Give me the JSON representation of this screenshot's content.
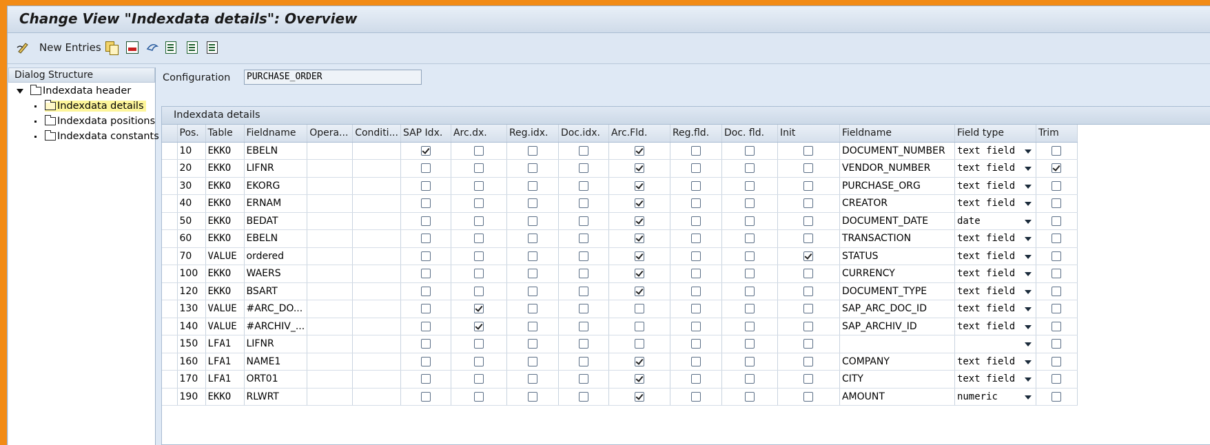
{
  "title": "Change View \"Indexdata details\": Overview",
  "toolbar": {
    "new_entries": "New Entries"
  },
  "dialog_structure": {
    "header": "Dialog Structure",
    "root": "Indexdata header",
    "items": [
      "Indexdata details",
      "Indexdata positions",
      "Indexdata constants"
    ],
    "selected": "Indexdata details"
  },
  "config": {
    "label": "Configuration",
    "value": "PURCHASE_ORDER"
  },
  "section_title": "Indexdata details",
  "columns": [
    "Pos.",
    "Table",
    "Fieldname",
    "Opera...",
    "Conditi...",
    "SAP Idx.",
    "Arc.dx.",
    "Reg.idx.",
    "Doc.idx.",
    "Arc.Fld.",
    "Reg.fld.",
    "Doc. fld.",
    "Init",
    "Fieldname",
    "Field type",
    "Trim"
  ],
  "rows": [
    {
      "pos": "10",
      "table": "EKKO",
      "field": "EBELN",
      "sap": true,
      "arc": false,
      "reg": false,
      "doc": false,
      "arcfld": true,
      "regfld": false,
      "docfld": false,
      "init": false,
      "fname": "DOCUMENT_NUMBER",
      "ftype": "text field",
      "trim": false
    },
    {
      "pos": "20",
      "table": "EKKO",
      "field": "LIFNR",
      "sap": false,
      "arc": false,
      "reg": false,
      "doc": false,
      "arcfld": true,
      "regfld": false,
      "docfld": false,
      "init": false,
      "fname": "VENDOR_NUMBER",
      "ftype": "text field",
      "trim": true
    },
    {
      "pos": "30",
      "table": "EKKO",
      "field": "EKORG",
      "sap": false,
      "arc": false,
      "reg": false,
      "doc": false,
      "arcfld": true,
      "regfld": false,
      "docfld": false,
      "init": false,
      "fname": "PURCHASE_ORG",
      "ftype": "text field",
      "trim": false
    },
    {
      "pos": "40",
      "table": "EKKO",
      "field": "ERNAM",
      "sap": false,
      "arc": false,
      "reg": false,
      "doc": false,
      "arcfld": true,
      "regfld": false,
      "docfld": false,
      "init": false,
      "fname": "CREATOR",
      "ftype": "text field",
      "trim": false
    },
    {
      "pos": "50",
      "table": "EKKO",
      "field": "BEDAT",
      "sap": false,
      "arc": false,
      "reg": false,
      "doc": false,
      "arcfld": true,
      "regfld": false,
      "docfld": false,
      "init": false,
      "fname": "DOCUMENT_DATE",
      "ftype": "date",
      "trim": false
    },
    {
      "pos": "60",
      "table": "EKKO",
      "field": "EBELN",
      "sap": false,
      "arc": false,
      "reg": false,
      "doc": false,
      "arcfld": true,
      "regfld": false,
      "docfld": false,
      "init": false,
      "fname": "TRANSACTION",
      "ftype": "text field",
      "trim": false
    },
    {
      "pos": "70",
      "table": "VALUE",
      "field": "ordered",
      "sap": false,
      "arc": false,
      "reg": false,
      "doc": false,
      "arcfld": true,
      "regfld": false,
      "docfld": false,
      "init": true,
      "fname": "STATUS",
      "ftype": "text field",
      "trim": false
    },
    {
      "pos": "100",
      "table": "EKKO",
      "field": "WAERS",
      "sap": false,
      "arc": false,
      "reg": false,
      "doc": false,
      "arcfld": true,
      "regfld": false,
      "docfld": false,
      "init": false,
      "fname": "CURRENCY",
      "ftype": "text field",
      "trim": false
    },
    {
      "pos": "120",
      "table": "EKKO",
      "field": "BSART",
      "sap": false,
      "arc": false,
      "reg": false,
      "doc": false,
      "arcfld": true,
      "regfld": false,
      "docfld": false,
      "init": false,
      "fname": "DOCUMENT_TYPE",
      "ftype": "text field",
      "trim": false
    },
    {
      "pos": "130",
      "table": "VALUE",
      "field": "#ARC_DO...",
      "sap": false,
      "arc": true,
      "reg": false,
      "doc": false,
      "arcfld": false,
      "regfld": false,
      "docfld": false,
      "init": false,
      "fname": "SAP_ARC_DOC_ID",
      "ftype": "text field",
      "trim": false
    },
    {
      "pos": "140",
      "table": "VALUE",
      "field": "#ARCHIV_...",
      "sap": false,
      "arc": true,
      "reg": false,
      "doc": false,
      "arcfld": false,
      "regfld": false,
      "docfld": false,
      "init": false,
      "fname": "SAP_ARCHIV_ID",
      "ftype": "text field",
      "trim": false
    },
    {
      "pos": "150",
      "table": "LFA1",
      "field": "LIFNR",
      "sap": false,
      "arc": false,
      "reg": false,
      "doc": false,
      "arcfld": false,
      "regfld": false,
      "docfld": false,
      "init": false,
      "fname": "",
      "ftype": "",
      "trim": false
    },
    {
      "pos": "160",
      "table": "LFA1",
      "field": "NAME1",
      "sap": false,
      "arc": false,
      "reg": false,
      "doc": false,
      "arcfld": true,
      "regfld": false,
      "docfld": false,
      "init": false,
      "fname": "COMPANY",
      "ftype": "text field",
      "trim": false
    },
    {
      "pos": "170",
      "table": "LFA1",
      "field": "ORT01",
      "sap": false,
      "arc": false,
      "reg": false,
      "doc": false,
      "arcfld": true,
      "regfld": false,
      "docfld": false,
      "init": false,
      "fname": "CITY",
      "ftype": "text field",
      "trim": false
    },
    {
      "pos": "190",
      "table": "EKKO",
      "field": "RLWRT",
      "sap": false,
      "arc": false,
      "reg": false,
      "doc": false,
      "arcfld": true,
      "regfld": false,
      "docfld": false,
      "init": false,
      "fname": "AMOUNT",
      "ftype": "numeric",
      "trim": false
    }
  ]
}
